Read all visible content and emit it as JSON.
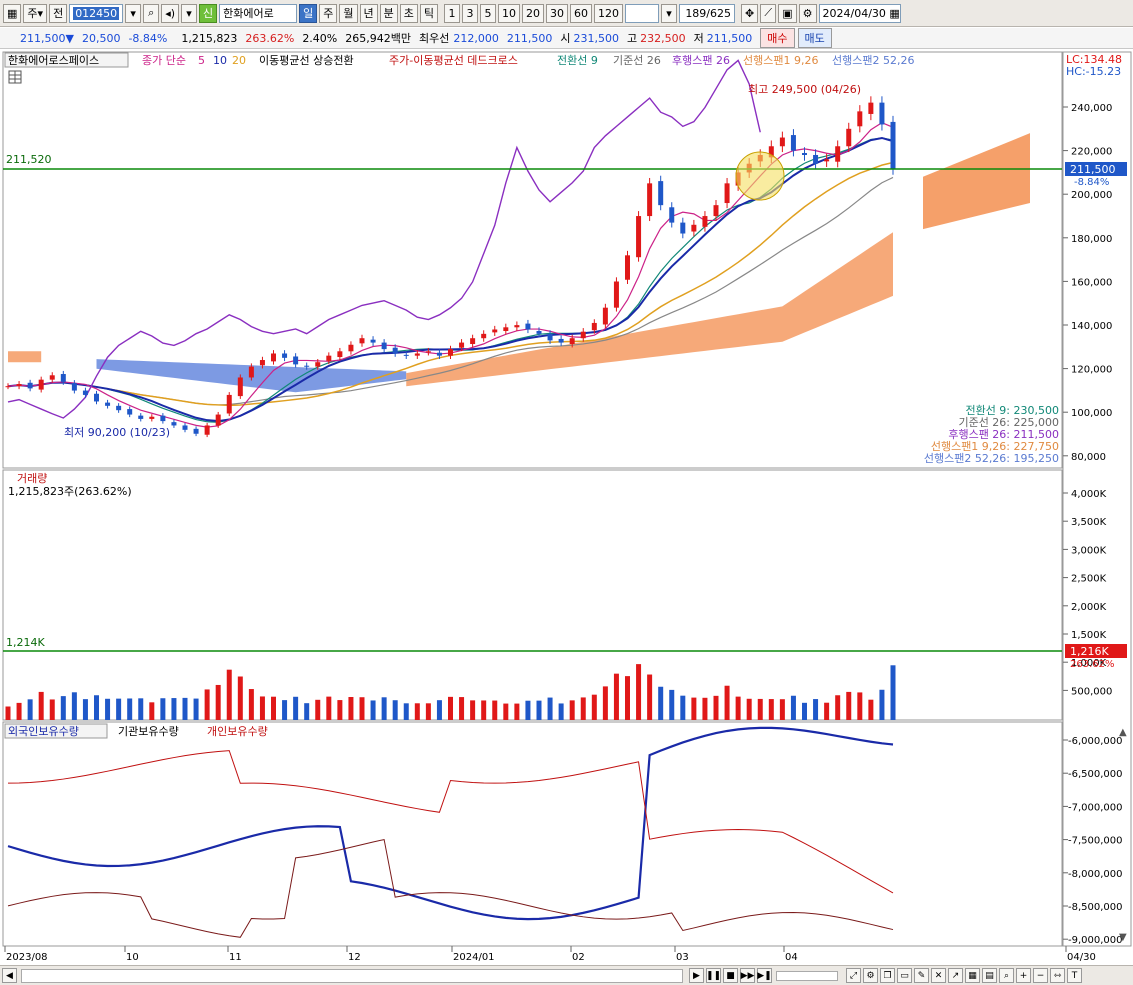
{
  "toolbar": {
    "type_label": "주",
    "jeon_label": "전",
    "code": "012450",
    "stock_name": "한화에어로",
    "shin_badge": "신",
    "periods": [
      "일",
      "주",
      "월",
      "년",
      "분",
      "초",
      "틱"
    ],
    "active_period": "일",
    "multipliers": [
      "1",
      "3",
      "5",
      "10",
      "20",
      "30",
      "60",
      "120"
    ],
    "count": "189/625",
    "date": "2024/04/30"
  },
  "quote": {
    "price": "211,500▼",
    "change": "20,500",
    "change_pct": "-8.84%",
    "volume": "1,215,823",
    "volume_pct": "263.62%",
    "turnover_ratio": "2.40%",
    "amount": "265,942백만",
    "best_bid_label": "최우선",
    "best_ask": "212,000",
    "best_bid": "211,500",
    "open_label": "시",
    "open": "231,500",
    "high_label": "고",
    "high": "232,500",
    "low_label": "저",
    "low": "211,500",
    "buy_label": "매수",
    "sell_label": "매도"
  },
  "legend": {
    "name": "한화에어로스페이스",
    "ma_label": "종가 단순",
    "ma5": "5",
    "ma10": "10",
    "ma20": "20",
    "signal1": "이동평균선 상승전환",
    "signal2": "주가-이동평균선 데드크로스",
    "ichimoku_conv": "전환선 9",
    "ichimoku_base": "기준선 26",
    "ichimoku_lag": "후행스팬 26",
    "ichimoku_lead1": "선행스팬1 9,26",
    "ichimoku_lead2": "선행스팬2 52,26"
  },
  "top_right": {
    "lc": "LC:134.48",
    "hc": "HC:-15.23"
  },
  "price_panel": {
    "hline_label": "211,520",
    "current_tag": "211,500",
    "current_pct": "-8.84%",
    "high_label": "최고 249,500 (04/26)",
    "low_label": "최저 90,200 (10/23)",
    "y_ticks": [
      "240,000",
      "220,000",
      "200,000",
      "180,000",
      "160,000",
      "140,000",
      "120,000",
      "100,000",
      "80,000"
    ],
    "info": [
      "전환선 9: 230,500",
      "기준선 26: 225,000",
      "후행스팬 26: 211,500",
      "선행스팬1 9,26: 227,750",
      "선행스팬2 52,26: 195,250"
    ]
  },
  "volume_panel": {
    "title": "거래량",
    "sub": "1,215,823주(263.62%)",
    "hline_label": "1,214K",
    "current_tag": "1,216K",
    "current_pct": "263.62%",
    "y_ticks": [
      "4,000K",
      "3,500K",
      "3,000K",
      "2,500K",
      "2,000K",
      "1,500K",
      "1,000K",
      "500,000"
    ]
  },
  "holding_panel": {
    "legend": [
      "외국인보유수량",
      "기관보유수량",
      "개인보유수량"
    ],
    "y_ticks": [
      "-6,000,000",
      "-6,500,000",
      "-7,000,000",
      "-7,500,000",
      "-8,000,000",
      "-8,500,000",
      "-9,000,000"
    ]
  },
  "x_axis": [
    "2023/08",
    "10",
    "11",
    "12",
    "2024/01",
    "02",
    "03",
    "04",
    "04/30"
  ],
  "colors": {
    "up": "#e01818",
    "down": "#1f57c8",
    "ma5": "#cc2288",
    "ma10": "#1a2aa8",
    "ma20": "#e0a020",
    "conv": "#118877",
    "base": "#888888",
    "lag": "#8a2fc0",
    "cloud_up": "#f5a06a",
    "cloud_down": "#6f8fe0",
    "hline": "#0a8a0a"
  },
  "chart_data": [
    {
      "type": "candlestick",
      "title": "한화에어로스페이스",
      "ylim": [
        80000,
        250000
      ],
      "high_point": {
        "value": 249500,
        "date": "04/26"
      },
      "low_point": {
        "value": 90200,
        "date": "10/23"
      },
      "last": 211500,
      "x_labels": [
        "2023/08",
        "10",
        "11",
        "12",
        "2024/01",
        "02",
        "03",
        "04",
        "04/30"
      ],
      "close_series": [
        112000,
        113000,
        111000,
        115000,
        117000,
        114000,
        110000,
        108000,
        105000,
        103000,
        101000,
        99000,
        97000,
        98000,
        96000,
        94000,
        92000,
        90200,
        94000,
        99000,
        108000,
        116000,
        121000,
        124000,
        127000,
        125000,
        122000,
        121000,
        123000,
        126000,
        128000,
        131000,
        134000,
        132000,
        129000,
        127000,
        126000,
        127000,
        128000,
        126000,
        129000,
        132000,
        134000,
        136000,
        138000,
        139000,
        140000,
        138000,
        136000,
        133000,
        132000,
        134000,
        137000,
        141000,
        148000,
        160000,
        172000,
        190000,
        205000,
        195000,
        187000,
        182000,
        186000,
        190000,
        195000,
        205000,
        210000,
        214000,
        218000,
        222000,
        226000,
        220000,
        218000,
        214000,
        216000,
        222000,
        230000,
        238000,
        242000,
        232000,
        211500
      ]
    },
    {
      "type": "bar",
      "title": "거래량",
      "ylim": [
        0,
        4200000
      ],
      "last": 1215823
    },
    {
      "type": "line",
      "series": [
        {
          "name": "외국인보유수량"
        },
        {
          "name": "기관보유수량"
        },
        {
          "name": "개인보유수량"
        }
      ],
      "ylim": [
        -9000000,
        -6000000
      ]
    }
  ]
}
